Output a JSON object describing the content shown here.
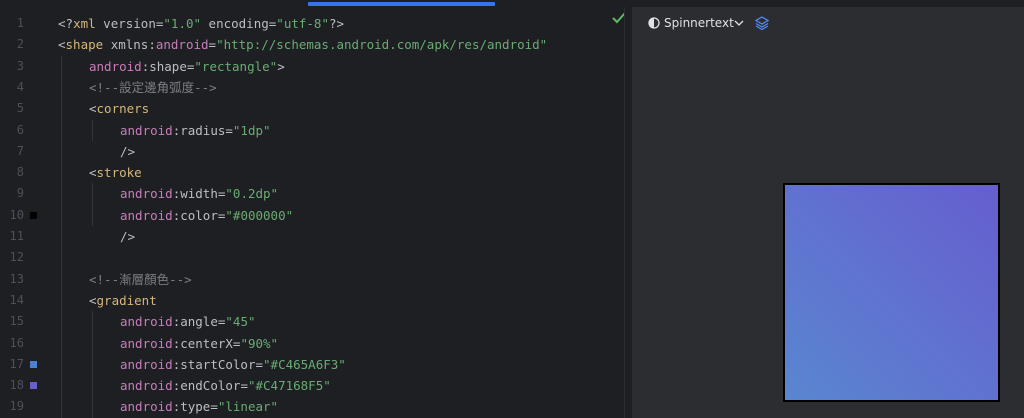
{
  "editor": {
    "lines": [
      {
        "num": "1",
        "indent": 0,
        "tokens": [
          [
            "punc",
            "<?"
          ],
          [
            "tag",
            "xml"
          ],
          [
            "attr",
            " version"
          ],
          [
            "punc",
            "="
          ],
          [
            "str",
            "\"1.0\""
          ],
          [
            "attr",
            " encoding"
          ],
          [
            "punc",
            "="
          ],
          [
            "str",
            "\"utf-8\""
          ],
          [
            "punc",
            "?>"
          ]
        ]
      },
      {
        "num": "2",
        "indent": 0,
        "tokens": [
          [
            "punc",
            "<"
          ],
          [
            "tag",
            "shape"
          ],
          [
            "attr",
            " xmlns"
          ],
          [
            "punc",
            ":"
          ],
          [
            "ns",
            "android"
          ],
          [
            "punc",
            "="
          ],
          [
            "str",
            "\"http://schemas.android.com/apk/res/android\""
          ]
        ]
      },
      {
        "num": "3",
        "indent": 1,
        "tokens": [
          [
            "ns",
            "android"
          ],
          [
            "punc",
            ":"
          ],
          [
            "attr",
            "shape"
          ],
          [
            "punc",
            "="
          ],
          [
            "str",
            "\"rectangle\""
          ],
          [
            "punc",
            ">"
          ]
        ]
      },
      {
        "num": "4",
        "indent": 1,
        "tokens": [
          [
            "cmt",
            "<!--設定邊角弧度-->"
          ]
        ]
      },
      {
        "num": "5",
        "indent": 1,
        "tokens": [
          [
            "punc",
            "<"
          ],
          [
            "tag",
            "corners"
          ]
        ]
      },
      {
        "num": "6",
        "indent": 2,
        "tokens": [
          [
            "ns",
            "android"
          ],
          [
            "punc",
            ":"
          ],
          [
            "attr",
            "radius"
          ],
          [
            "punc",
            "="
          ],
          [
            "str",
            "\"1dp\""
          ]
        ]
      },
      {
        "num": "7",
        "indent": 2,
        "tokens": [
          [
            "punc",
            "/>"
          ]
        ]
      },
      {
        "num": "8",
        "indent": 1,
        "tokens": [
          [
            "punc",
            "<"
          ],
          [
            "tag",
            "stroke"
          ]
        ]
      },
      {
        "num": "9",
        "indent": 2,
        "tokens": [
          [
            "ns",
            "android"
          ],
          [
            "punc",
            ":"
          ],
          [
            "attr",
            "width"
          ],
          [
            "punc",
            "="
          ],
          [
            "str",
            "\"0.2dp\""
          ]
        ]
      },
      {
        "num": "10",
        "indent": 2,
        "tokens": [
          [
            "ns",
            "android"
          ],
          [
            "punc",
            ":"
          ],
          [
            "attr",
            "color"
          ],
          [
            "punc",
            "="
          ],
          [
            "str",
            "\"#000000\""
          ]
        ]
      },
      {
        "num": "11",
        "indent": 2,
        "tokens": [
          [
            "punc",
            "/>"
          ]
        ]
      },
      {
        "num": "12",
        "indent": 0,
        "tokens": []
      },
      {
        "num": "13",
        "indent": 1,
        "tokens": [
          [
            "cmt",
            "<!--漸層顏色-->"
          ]
        ]
      },
      {
        "num": "14",
        "indent": 1,
        "tokens": [
          [
            "punc",
            "<"
          ],
          [
            "tag",
            "gradient"
          ]
        ]
      },
      {
        "num": "15",
        "indent": 2,
        "tokens": [
          [
            "ns",
            "android"
          ],
          [
            "punc",
            ":"
          ],
          [
            "attr",
            "angle"
          ],
          [
            "punc",
            "="
          ],
          [
            "str",
            "\"45\""
          ]
        ]
      },
      {
        "num": "16",
        "indent": 2,
        "tokens": [
          [
            "ns",
            "android"
          ],
          [
            "punc",
            ":"
          ],
          [
            "attr",
            "centerX"
          ],
          [
            "punc",
            "="
          ],
          [
            "str",
            "\"90%\""
          ]
        ]
      },
      {
        "num": "17",
        "indent": 2,
        "tokens": [
          [
            "ns",
            "android"
          ],
          [
            "punc",
            ":"
          ],
          [
            "attr",
            "startColor"
          ],
          [
            "punc",
            "="
          ],
          [
            "str",
            "\"#C465A6F3\""
          ]
        ]
      },
      {
        "num": "18",
        "indent": 2,
        "tokens": [
          [
            "ns",
            "android"
          ],
          [
            "punc",
            ":"
          ],
          [
            "attr",
            "endColor"
          ],
          [
            "punc",
            "="
          ],
          [
            "str",
            "\"#C47168F5\""
          ]
        ]
      },
      {
        "num": "19",
        "indent": 2,
        "tokens": [
          [
            "ns",
            "android"
          ],
          [
            "punc",
            ":"
          ],
          [
            "attr",
            "type"
          ],
          [
            "punc",
            "="
          ],
          [
            "str",
            "\"linear\""
          ]
        ]
      }
    ],
    "gutter_swatches": [
      {
        "line": "10",
        "color": "#000000"
      },
      {
        "line": "17",
        "color": "#4f7fd0"
      },
      {
        "line": "18",
        "color": "#6660c8"
      }
    ]
  },
  "preview": {
    "theme_label": "Spinnertext",
    "gradient_start": "#5a86d0",
    "gradient_end": "#665ecf",
    "stroke_color": "#000000"
  },
  "colors": {
    "accent": "#3574f0",
    "check": "#5fb865"
  }
}
